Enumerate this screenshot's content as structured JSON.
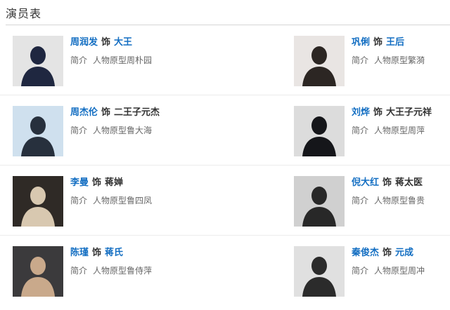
{
  "section": {
    "title": "演员表"
  },
  "cast": [
    {
      "left": {
        "actor": "周润发",
        "as": "饰",
        "role": "大王",
        "role_linked": true,
        "intro_label": "简介",
        "intro": "人物原型周朴园",
        "photo_bg": "#e4e4e4",
        "photo_fg": "#1f2740"
      },
      "right": {
        "actor": "巩俐",
        "as": "饰",
        "role": "王后",
        "role_linked": true,
        "intro_label": "简介",
        "intro": "人物原型繁漪",
        "photo_bg": "#e9e5e3",
        "photo_fg": "#2c2623"
      }
    },
    {
      "left": {
        "actor": "周杰伦",
        "as": "饰",
        "role": "二王子元杰",
        "role_linked": false,
        "intro_label": "简介",
        "intro": "人物原型鲁大海",
        "photo_bg": "#cfe0ee",
        "photo_fg": "#27303d"
      },
      "right": {
        "actor": "刘烨",
        "as": "饰",
        "role": "大王子元祥",
        "role_linked": false,
        "intro_label": "简介",
        "intro": "人物原型周萍",
        "photo_bg": "#dcdcdc",
        "photo_fg": "#15161a"
      }
    },
    {
      "left": {
        "actor": "李曼",
        "as": "饰",
        "role": "蒋婵",
        "role_linked": false,
        "intro_label": "简介",
        "intro": "人物原型鲁四凤",
        "photo_bg": "#2f2a26",
        "photo_fg": "#d8c8b0"
      },
      "right": {
        "actor": "倪大红",
        "as": "饰",
        "role": "蒋太医",
        "role_linked": false,
        "intro_label": "简介",
        "intro": "人物原型鲁贵",
        "photo_bg": "#d0d0d0",
        "photo_fg": "#282828"
      }
    },
    {
      "left": {
        "actor": "陈瑾",
        "as": "饰",
        "role": "蒋氏",
        "role_linked": true,
        "intro_label": "简介",
        "intro": "人物原型鲁侍萍",
        "photo_bg": "#3b3a3c",
        "photo_fg": "#c9a98b"
      },
      "right": {
        "actor": "秦俊杰",
        "as": "饰",
        "role": "元成",
        "role_linked": true,
        "intro_label": "简介",
        "intro": "人物原型周冲",
        "photo_bg": "#e0e0e0",
        "photo_fg": "#2b2b2b"
      }
    }
  ]
}
